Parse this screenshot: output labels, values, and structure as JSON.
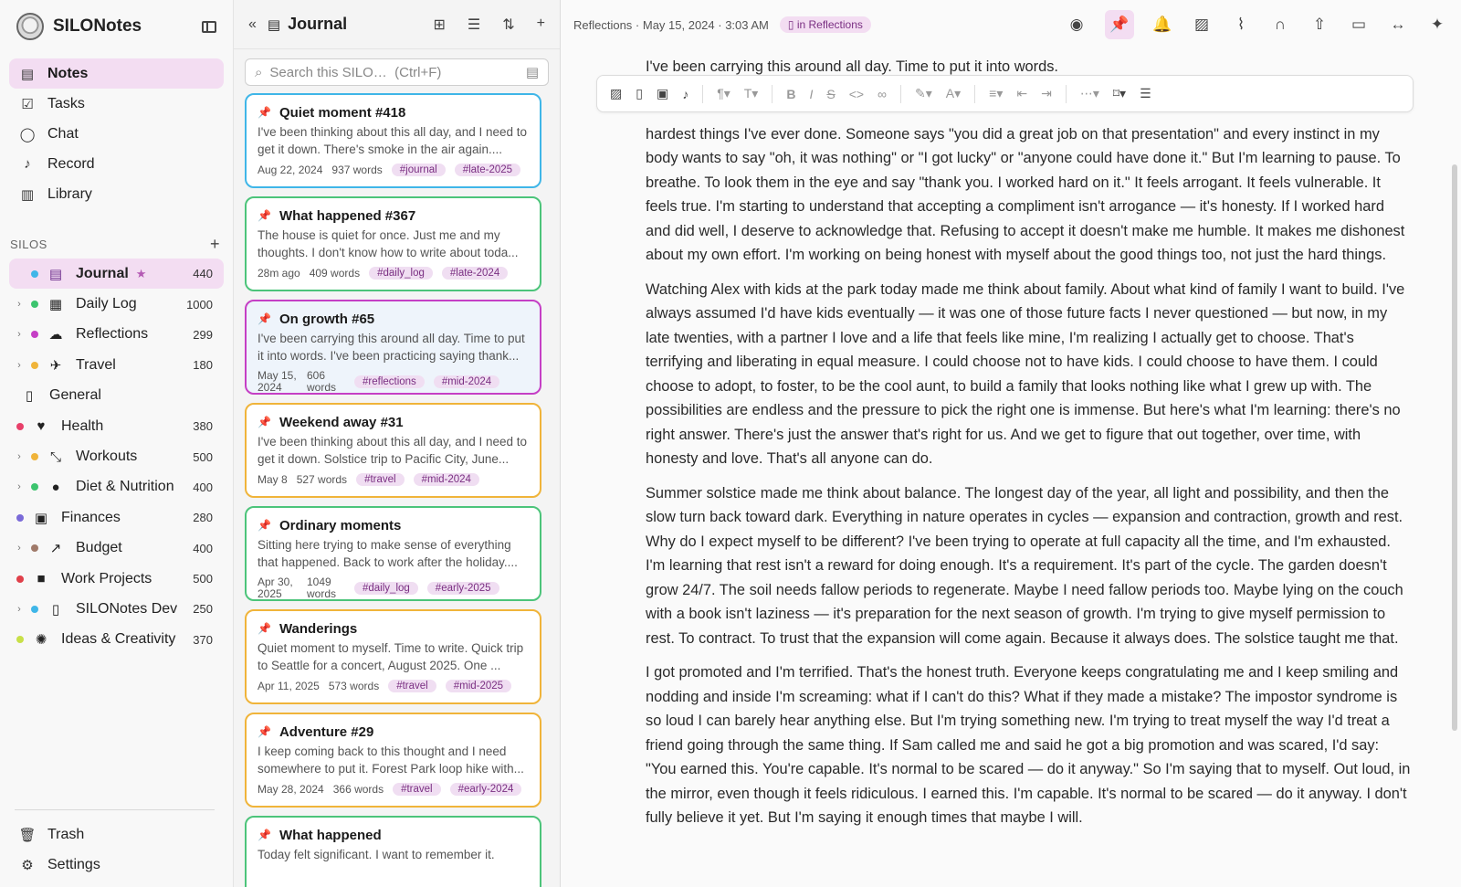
{
  "app": {
    "name": "SILONotes",
    "search_placeholder": "Search this SILO…  (Ctrl+F)"
  },
  "nav": [
    {
      "label": "Notes",
      "icon": "notes-icon"
    },
    {
      "label": "Tasks",
      "icon": "tasks-icon"
    },
    {
      "label": "Chat",
      "icon": "chat-icon"
    },
    {
      "label": "Record",
      "icon": "mic-icon"
    },
    {
      "label": "Library",
      "icon": "library-icon"
    }
  ],
  "silos_header": "SILOS",
  "silos": [
    {
      "name": "Journal",
      "count": "440",
      "dot": "#3fb6e8",
      "star": "★"
    },
    {
      "name": "Daily Log",
      "count": "1000",
      "dot": "#3cc46e"
    },
    {
      "name": "Reflections",
      "count": "299",
      "dot": "#c53fc5"
    },
    {
      "name": "Travel",
      "count": "180",
      "dot": "#f0b43a"
    },
    {
      "name": "General",
      "count": ""
    },
    {
      "name": "Health",
      "count": "380",
      "dot": "#e8406a"
    },
    {
      "name": "Workouts",
      "count": "500",
      "dot": "#f0b43a"
    },
    {
      "name": "Diet & Nutrition",
      "count": "400",
      "dot": "#3cc46e"
    },
    {
      "name": "Finances",
      "count": "280",
      "dot": "#7a6ad8"
    },
    {
      "name": "Budget",
      "count": "400",
      "dot": "#a07a6a"
    },
    {
      "name": "Work Projects",
      "count": "500",
      "dot": "#e0404a"
    },
    {
      "name": "SILONotes Dev",
      "count": "250",
      "dot": "#3fb6e8"
    },
    {
      "name": "Ideas & Creativity",
      "count": "370",
      "dot": "#c8e048"
    }
  ],
  "bottom_nav": [
    {
      "label": "Trash"
    },
    {
      "label": "Settings"
    }
  ],
  "list": {
    "title": "Journal",
    "cards": [
      {
        "title": "Quiet moment #418",
        "snippet": "I've been thinking about this all day, and I need to get it down. There's smoke in the air again....",
        "date": "Aug 22, 2024",
        "words": "937 words",
        "tags": [
          "#journal",
          "#late-2025"
        ],
        "border": "#3fb6e8"
      },
      {
        "title": "What happened #367",
        "snippet": "The house is quiet for once. Just me and my thoughts. I don't know how to write about toda...",
        "date": "28m ago",
        "words": "409 words",
        "tags": [
          "#daily_log",
          "#late-2024"
        ],
        "border": "#4cc47a"
      },
      {
        "title": "On growth #65",
        "snippet": "I've been carrying this around all day. Time to put it into words. I've been practicing saying thank...",
        "date": "May 15, 2024",
        "words": "606 words",
        "tags": [
          "#reflections",
          "#mid-2024"
        ],
        "border": "#c53fc5"
      },
      {
        "title": "Weekend away #31",
        "snippet": "I've been thinking about this all day, and I need to get it down. Solstice trip to Pacific City, June...",
        "date": "May 8",
        "words": "527 words",
        "tags": [
          "#travel",
          "#mid-2024"
        ],
        "border": "#f0b43a"
      },
      {
        "title": "Ordinary moments",
        "snippet": "Sitting here trying to make sense of everything that happened. Back to work after the holiday....",
        "date": "Apr 30, 2025",
        "words": "1049 words",
        "tags": [
          "#daily_log",
          "#early-2025"
        ],
        "border": "#4cc47a"
      },
      {
        "title": "Wanderings",
        "snippet": "Quiet moment to myself. Time to write. Quick trip to Seattle for a concert, August 2025. One ...",
        "date": "Apr 11, 2025",
        "words": "573 words",
        "tags": [
          "#travel",
          "#mid-2025"
        ],
        "border": "#f0b43a"
      },
      {
        "title": "Adventure #29",
        "snippet": "I keep coming back to this thought and I need somewhere to put it. Forest Park loop hike with...",
        "date": "May 28, 2024",
        "words": "366 words",
        "tags": [
          "#travel",
          "#early-2024"
        ],
        "border": "#f0b43a"
      },
      {
        "title": "What happened",
        "snippet": "Today felt significant. I want to remember it.",
        "date": "",
        "words": "",
        "tags": [],
        "border": "#4cc47a"
      }
    ]
  },
  "editor": {
    "breadcrumb": "Reflections · May 15, 2024 · 3:03 AM",
    "badge": "in Reflections",
    "paragraphs": [
      "I've been carrying this around all day. Time to put it into words.",
      "hardest things I've ever done. Someone says \"you did a great job on that presentation\" and every instinct in my body wants to say \"oh, it was nothing\" or \"I got lucky\" or \"anyone could have done it.\" But I'm learning to pause. To breathe. To look them in the eye and say \"thank you. I worked hard on it.\" It feels arrogant. It feels vulnerable. It feels true. I'm starting to understand that accepting a compliment isn't arrogance — it's honesty. If I worked hard and did well, I deserve to acknowledge that. Refusing to accept it doesn't make me humble. It makes me dishonest about my own effort. I'm working on being honest with myself about the good things too, not just the hard things.",
      "Watching Alex with kids at the park today made me think about family. About what kind of family I want to build. I've always assumed I'd have kids eventually — it was one of those future facts I never questioned — but now, in my late twenties, with a partner I love and a life that feels like mine, I'm realizing I actually get to choose. That's terrifying and liberating in equal measure. I could choose not to have kids. I could choose to have them. I could choose to adopt, to foster, to be the cool aunt, to build a family that looks nothing like what I grew up with. The possibilities are endless and the pressure to pick the right one is immense. But here's what I'm learning: there's no right answer. There's just the answer that's right for us. And we get to figure that out together, over time, with honesty and love. That's all anyone can do.",
      "Summer solstice made me think about balance. The longest day of the year, all light and possibility, and then the slow turn back toward dark. Everything in nature operates in cycles — expansion and contraction, growth and rest. Why do I expect myself to be different? I've been trying to operate at full capacity all the time, and I'm exhausted. I'm learning that rest isn't a reward for doing enough. It's a requirement. It's part of the cycle. The garden doesn't grow 24/7. The soil needs fallow periods to regenerate. Maybe I need fallow periods too. Maybe lying on the couch with a book isn't laziness — it's preparation for the next season of growth. I'm trying to give myself permission to rest. To contract. To trust that the expansion will come again. Because it always does. The solstice taught me that.",
      "I got promoted and I'm terrified. That's the honest truth. Everyone keeps congratulating me and I keep smiling and nodding and inside I'm screaming: what if I can't do this? What if they made a mistake? The impostor syndrome is so loud I can barely hear anything else. But I'm trying something new. I'm trying to treat myself the way I'd treat a friend going through the same thing. If Sam called me and said he got a big promotion and was scared, I'd say: \"You earned this. You're capable. It's normal to be scared — do it anyway.\" So I'm saying that to myself. Out loud, in the mirror, even though it feels ridiculous. I earned this. I'm capable. It's normal to be scared — do it anyway. I don't fully believe it yet. But I'm saying it enough times that maybe I will."
    ]
  }
}
